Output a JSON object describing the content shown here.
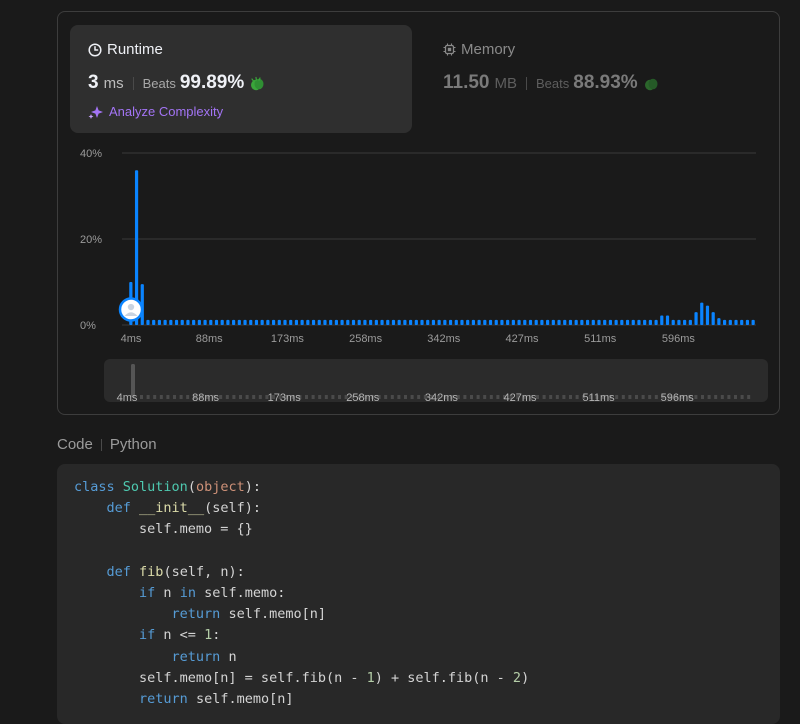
{
  "runtime": {
    "title": "Runtime",
    "value": "3",
    "unit": "ms",
    "beats_label": "Beats",
    "beats_pct": "99.89%",
    "analyze_label": "Analyze Complexity"
  },
  "memory": {
    "title": "Memory",
    "value": "11.50",
    "unit": "MB",
    "beats_label": "Beats",
    "beats_pct": "88.93%"
  },
  "chart_data": {
    "type": "bar",
    "title": "",
    "xlabel": "",
    "ylabel": "",
    "ylim": [
      0,
      40
    ],
    "yticks": [
      "0%",
      "20%",
      "40%"
    ],
    "xticks": [
      "4ms",
      "88ms",
      "173ms",
      "258ms",
      "342ms",
      "427ms",
      "511ms",
      "596ms"
    ],
    "values": [
      10,
      36,
      9.5,
      1.2,
      1.2,
      1.2,
      1.2,
      1.2,
      1.2,
      1.2,
      1.2,
      1.2,
      1.2,
      1.2,
      1.2,
      1.2,
      1.2,
      1.2,
      1.2,
      1.2,
      1.2,
      1.2,
      1.2,
      1.2,
      1.2,
      1.2,
      1.2,
      1.2,
      1.2,
      1.2,
      1.2,
      1.2,
      1.2,
      1.2,
      1.2,
      1.2,
      1.2,
      1.2,
      1.2,
      1.2,
      1.2,
      1.2,
      1.2,
      1.2,
      1.2,
      1.2,
      1.2,
      1.2,
      1.2,
      1.2,
      1.2,
      1.2,
      1.2,
      1.2,
      1.2,
      1.2,
      1.2,
      1.2,
      1.2,
      1.2,
      1.2,
      1.2,
      1.2,
      1.2,
      1.2,
      1.2,
      1.2,
      1.2,
      1.2,
      1.2,
      1.2,
      1.2,
      1.2,
      1.2,
      1.2,
      1.2,
      1.2,
      1.2,
      1.2,
      1.2,
      1.2,
      1.2,
      1.2,
      1.2,
      1.2,
      1.2,
      1.2,
      1.2,
      1.2,
      1.2,
      1.2,
      1.2,
      1.2,
      2.2,
      2.2,
      1.2,
      1.2,
      1.2,
      1.2,
      3,
      5.2,
      4.5,
      3,
      1.6,
      1.2,
      1.2,
      1.2,
      1.2,
      1.2,
      1.2
    ],
    "user_value": 3.6,
    "grid": true,
    "colors": {
      "bar": "#0a84ff",
      "grid": "#3a3a3a"
    }
  },
  "scrubber": {
    "labels": [
      "4ms",
      "88ms",
      "173ms",
      "258ms",
      "342ms",
      "427ms",
      "511ms",
      "596ms"
    ]
  },
  "code": {
    "tab_label": "Code",
    "language": "Python"
  }
}
